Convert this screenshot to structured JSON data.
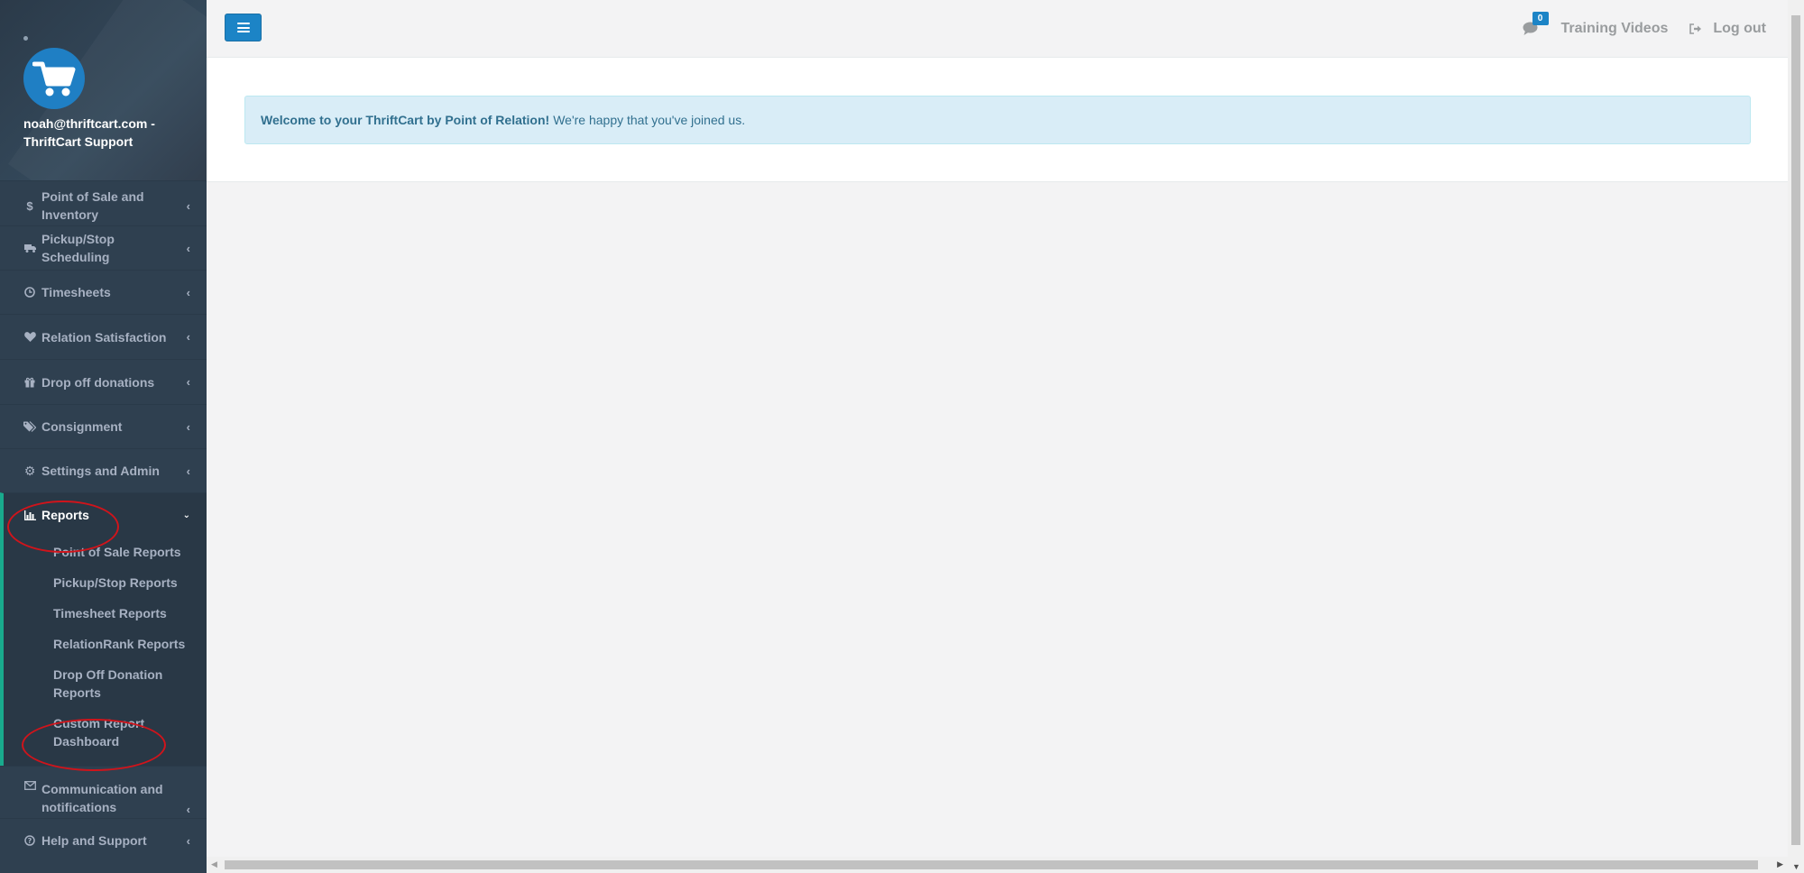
{
  "profile": {
    "user": "noah@thriftcart.com - ThriftCart Support"
  },
  "nav": {
    "items": [
      {
        "id": "pos",
        "label": "Point of Sale and Inventory",
        "icon": "dollar-icon"
      },
      {
        "id": "pickup",
        "label": "Pickup/Stop Scheduling",
        "icon": "truck-icon"
      },
      {
        "id": "timesheets",
        "label": "Timesheets",
        "icon": "clock-icon"
      },
      {
        "id": "relation",
        "label": "Relation Satisfaction",
        "icon": "heart-icon"
      },
      {
        "id": "dropoff",
        "label": "Drop off donations",
        "icon": "gift-icon"
      },
      {
        "id": "consignment",
        "label": "Consignment",
        "icon": "tags-icon"
      },
      {
        "id": "settings",
        "label": "Settings and Admin",
        "icon": "gear-icon"
      },
      {
        "id": "reports",
        "label": "Reports",
        "icon": "bar-chart-icon"
      },
      {
        "id": "communication",
        "label": "Communication and notifications",
        "icon": "envelope-icon"
      },
      {
        "id": "help",
        "label": "Help and Support",
        "icon": "question-circle-icon"
      }
    ],
    "reports_sub": [
      "Point of Sale Reports",
      "Pickup/Stop Reports",
      "Timesheet Reports",
      "RelationRank Reports",
      "Drop Off Donation Reports",
      "Custom Report Dashboard"
    ]
  },
  "topbar": {
    "message_count": "0",
    "training_videos": "Training Videos",
    "logout": "Log out"
  },
  "alert": {
    "strong": "Welcome to your ThriftCart by Point of Relation!",
    "text": "We're happy that you've joined us."
  },
  "colors": {
    "sidebar_bg": "#2f4050",
    "accent_green": "#19aa8d",
    "primary_blue": "#1c84c6",
    "alert_bg": "#d9edf7",
    "annotation_red": "#d0141b"
  }
}
